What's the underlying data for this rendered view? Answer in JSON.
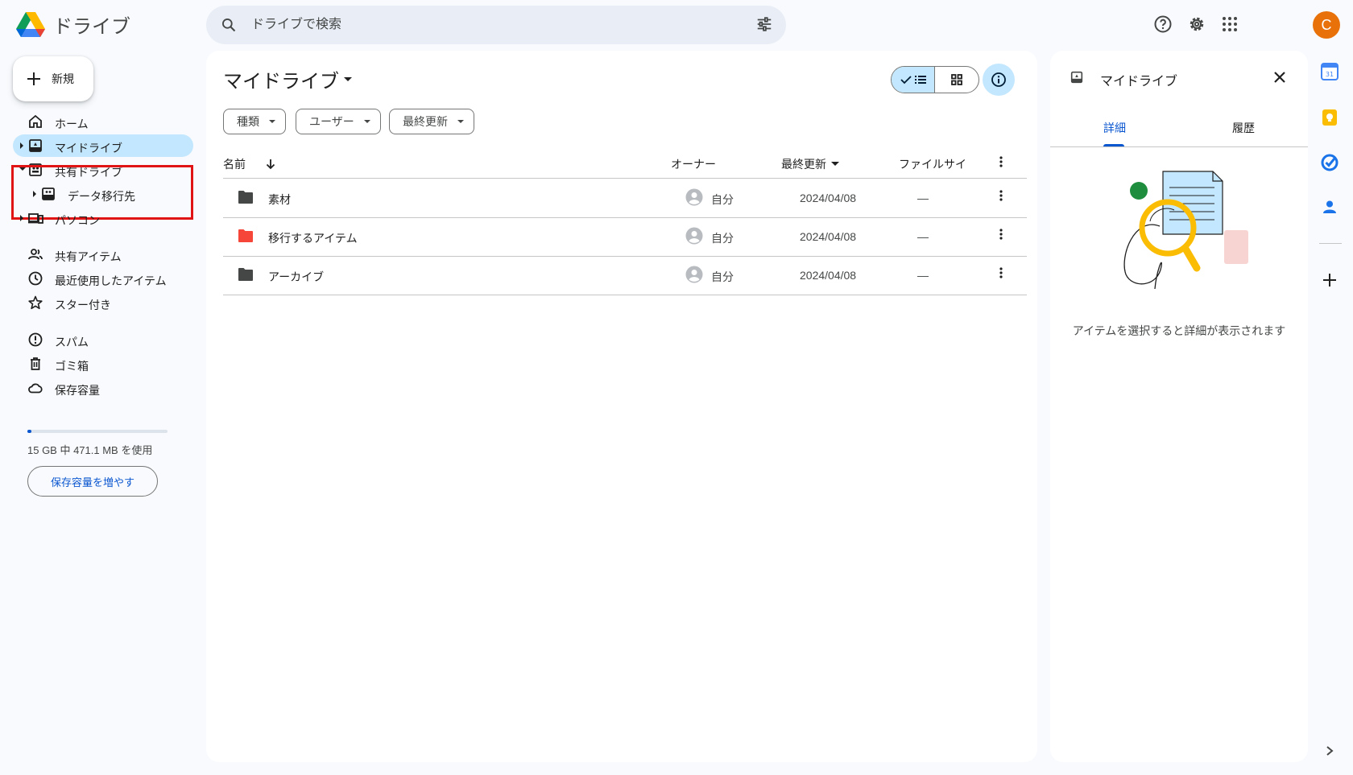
{
  "app": {
    "name": "ドライブ"
  },
  "search": {
    "placeholder": "ドライブで検索"
  },
  "header": {
    "avatar_letter": "C",
    "help_icon": "help-icon",
    "settings_icon": "gear-icon",
    "apps_icon": "apps-grid-icon"
  },
  "sidebar": {
    "new_label": "新規",
    "items": [
      {
        "label": "ホーム",
        "icon": "home-icon"
      },
      {
        "label": "マイドライブ",
        "icon": "my-drive-icon"
      },
      {
        "label": "共有ドライブ",
        "icon": "shared-drives-icon"
      },
      {
        "label": "データ移行先",
        "icon": "shared-drive-icon"
      },
      {
        "label": "パソコン",
        "icon": "computers-icon"
      },
      {
        "label": "共有アイテム",
        "icon": "people-icon"
      },
      {
        "label": "最近使用したアイテム",
        "icon": "clock-icon"
      },
      {
        "label": "スター付き",
        "icon": "star-icon"
      },
      {
        "label": "スパム",
        "icon": "spam-icon"
      },
      {
        "label": "ゴミ箱",
        "icon": "trash-icon"
      },
      {
        "label": "保存容量",
        "icon": "cloud-icon"
      }
    ],
    "storage": {
      "text": "15 GB 中 471.1 MB を使用",
      "used_fraction": 0.03,
      "button": "保存容量を増やす"
    }
  },
  "main": {
    "title": "マイドライブ",
    "filters": [
      "種類",
      "ユーザー",
      "最終更新"
    ],
    "columns": {
      "name": "名前",
      "owner": "オーナー",
      "modified": "最終更新",
      "size": "ファイルサイ"
    },
    "rows": [
      {
        "name": "素材",
        "owner": "自分",
        "date": "2024/04/08",
        "size": "—",
        "folder_color": "#444746"
      },
      {
        "name": "移行するアイテム",
        "owner": "自分",
        "date": "2024/04/08",
        "size": "—",
        "folder_color": "#f6463a"
      },
      {
        "name": "アーカイブ",
        "owner": "自分",
        "date": "2024/04/08",
        "size": "—",
        "folder_color": "#444746"
      }
    ]
  },
  "details": {
    "title": "マイドライブ",
    "tabs": [
      "詳細",
      "履歴"
    ],
    "hint": "アイテムを選択すると詳細が表示されます"
  },
  "colors": {
    "accent": "#0b57d0",
    "active_bg": "#c2e7ff",
    "highlight": "#e01414",
    "avatar": "#e8710a"
  }
}
